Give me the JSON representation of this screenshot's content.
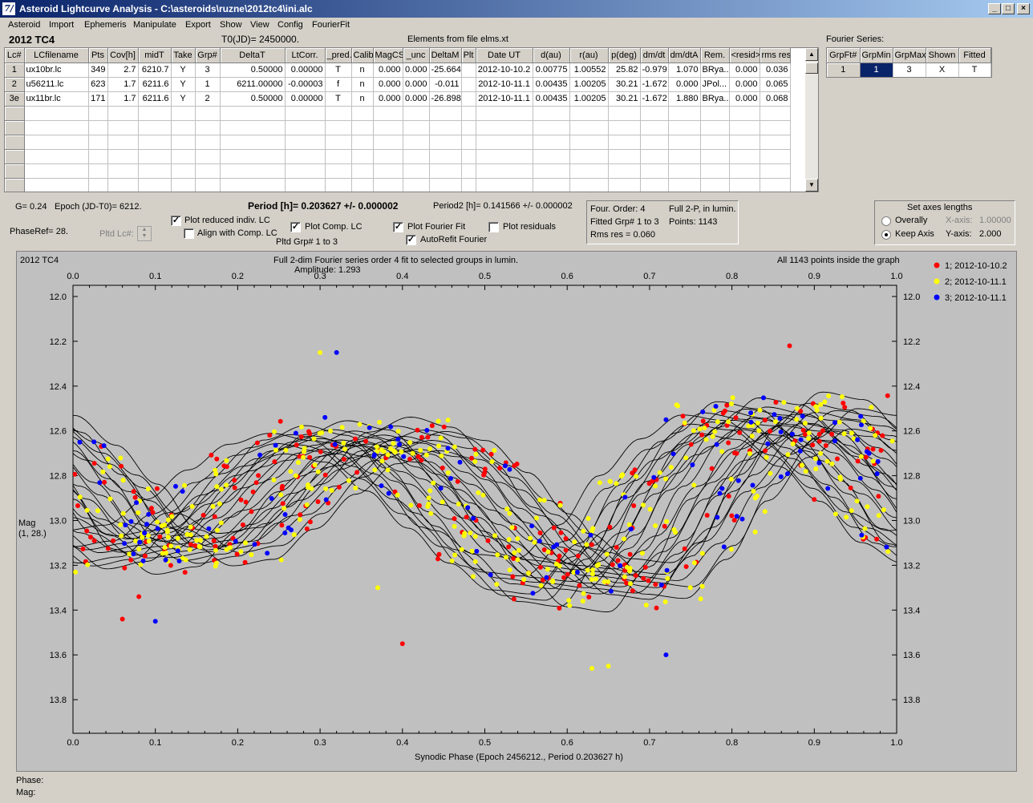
{
  "window": {
    "title": "Asteroid Lightcurve Analysis - C:\\asteroids\\ruzne\\2012tc4\\ini.alc",
    "icon": "7/"
  },
  "menu": [
    "Asteroid",
    "Import",
    "Ephemeris",
    "Manipulate",
    "Export",
    "Show",
    "View",
    "Config",
    "FourierFit"
  ],
  "header": {
    "asteroid": "2012 TC4",
    "t0": "T0(JD)= 2450000.",
    "elements": "Elements from file elms.xt",
    "fourier_label": "Fourier Series:"
  },
  "lc_table": {
    "columns": [
      "Lc#",
      "LCfilename",
      "Pts",
      "Cov[h]",
      "midT",
      "Take",
      "Grp#",
      "DeltaT",
      "LtCorr.",
      "_pred.",
      "Calib.",
      "MagCS",
      "_unc",
      "DeltaM",
      "Plt",
      "Date UT",
      "d(au)",
      "r(au)",
      "p(deg)",
      "dm/dt",
      "dm/dtA",
      "Rem.",
      "<resid>",
      "rms res"
    ],
    "rows": [
      [
        "1",
        "ux10br.lc",
        "349",
        "2.7",
        "6210.7",
        "Y",
        "3",
        "0.50000",
        "0.00000",
        "T",
        "n",
        "0.000",
        "0.000",
        "-25.664",
        "",
        "2012-10-10.2",
        "0.00775",
        "1.00552",
        "25.82",
        "-0.979",
        "1.070",
        "BRya...",
        "0.000",
        "0.036"
      ],
      [
        "2",
        "u56211.lc",
        "623",
        "1.7",
        "6211.6",
        "Y",
        "1",
        "6211.00000",
        "-0.00003",
        "f",
        "n",
        "0.000",
        "0.000",
        "-0.011",
        "",
        "2012-10-11.1",
        "0.00435",
        "1.00205",
        "30.21",
        "-1.672",
        "0.000",
        "JPol...",
        "0.000",
        "0.065"
      ],
      [
        "3e",
        "ux11br.lc",
        "171",
        "1.7",
        "6211.6",
        "Y",
        "2",
        "0.50000",
        "0.00000",
        "T",
        "n",
        "0.000",
        "0.000",
        "-26.898",
        "",
        "2012-10-11.1",
        "0.00435",
        "1.00205",
        "30.21",
        "-1.672",
        "1.880",
        "BRya...",
        "0.000",
        "0.068"
      ]
    ]
  },
  "fourier_table": {
    "columns": [
      "GrpFt#",
      "GrpMin",
      "GrpMax",
      "Shown",
      "Fitted"
    ],
    "rows": [
      [
        "1",
        "1",
        "3",
        "X",
        "T"
      ]
    ]
  },
  "info": {
    "g": "G= 0.24",
    "epoch": "Epoch (JD-T0)= 6212.",
    "period": "Period [h]= 0.203627 +/- 0.000002",
    "period2": "Period2 [h]= 0.141566 +/- 0.000002",
    "phase_ref": "PhaseRef= 28.",
    "pltd_lc": "Pltd Lc#:",
    "plot_reduced": "Plot reduced indiv. LC",
    "align_comp": "Align with Comp. LC",
    "plot_comp": "Plot Comp. LC",
    "pltd_grp": "Pltd Grp#  1   to   3",
    "plot_fourier": "Plot Fourier Fit",
    "autorefit": "AutoRefit Fourier",
    "plot_residuals": "Plot residuals",
    "four_order": "Four. Order:  4",
    "fitted_grp": "Fitted Grp# 1 to 3",
    "rms_res": "Rms res     = 0.060",
    "full2p": "Full 2-P, in lumin.",
    "points": "Points: 1143",
    "axes_title": "Set axes lengths",
    "overally": "Overally",
    "keep_axis": "Keep Axis",
    "xaxis_lbl": "X-axis:",
    "xaxis_val": "1.00000",
    "yaxis_lbl": "Y-axis:",
    "yaxis_val": "2.000",
    "phase": "Phase:",
    "mag": "Mag:"
  },
  "chart_data": {
    "type": "scatter",
    "title": "Full 2-dim Fourier series order 4 fit to selected groups in lumin.",
    "subtitle": "Amplitude: 1.293",
    "corner_left": "2012 TC4",
    "corner_right": "All 1143 points inside the graph",
    "xlabel": "Synodic Phase (Epoch 2456212., Period 0.203627 h)",
    "ylabel": "Mag",
    "ylabel2": "(1, 28.)",
    "xlim": [
      0,
      1
    ],
    "ylim": [
      13.95,
      11.95
    ],
    "x_ticks": [
      "0.0",
      "0.1",
      "0.2",
      "0.3",
      "0.4",
      "0.5",
      "0.6",
      "0.7",
      "0.8",
      "0.9",
      "1.0"
    ],
    "y_ticks": [
      "12.0",
      "12.2",
      "12.4",
      "12.6",
      "12.8",
      "13.0",
      "13.2",
      "13.4",
      "13.6",
      "13.8"
    ],
    "legend": [
      {
        "name": "1; 2012-10-10.2",
        "color": "#ff0000"
      },
      {
        "name": "2; 2012-10-11.1",
        "color": "#ffff00"
      },
      {
        "name": "3; 2012-10-11.1",
        "color": "#0000ff"
      }
    ],
    "series_colors": [
      "#ff0000",
      "#ffff00",
      "#0000ff"
    ],
    "mean_curve": [
      [
        0.0,
        12.85
      ],
      [
        0.05,
        13.05
      ],
      [
        0.1,
        13.15
      ],
      [
        0.15,
        13.12
      ],
      [
        0.2,
        12.98
      ],
      [
        0.25,
        12.82
      ],
      [
        0.3,
        12.68
      ],
      [
        0.35,
        12.62
      ],
      [
        0.4,
        12.66
      ],
      [
        0.45,
        12.8
      ],
      [
        0.5,
        12.98
      ],
      [
        0.55,
        13.15
      ],
      [
        0.6,
        13.28
      ],
      [
        0.65,
        13.3
      ],
      [
        0.7,
        13.12
      ],
      [
        0.75,
        12.85
      ],
      [
        0.8,
        12.65
      ],
      [
        0.85,
        12.52
      ],
      [
        0.9,
        12.55
      ],
      [
        0.95,
        12.68
      ],
      [
        1.0,
        12.85
      ]
    ],
    "highlighted_points": [
      [
        0.08,
        13.34
      ],
      [
        0.63,
        13.66
      ],
      [
        0.1,
        13.45
      ],
      [
        0.4,
        13.55
      ],
      [
        0.37,
        13.3
      ],
      [
        0.72,
        12.55
      ],
      [
        0.87,
        12.22
      ],
      [
        0.3,
        12.25
      ],
      [
        0.32,
        12.25
      ],
      [
        0.06,
        13.44
      ],
      [
        0.65,
        13.65
      ],
      [
        0.72,
        13.6
      ]
    ]
  }
}
